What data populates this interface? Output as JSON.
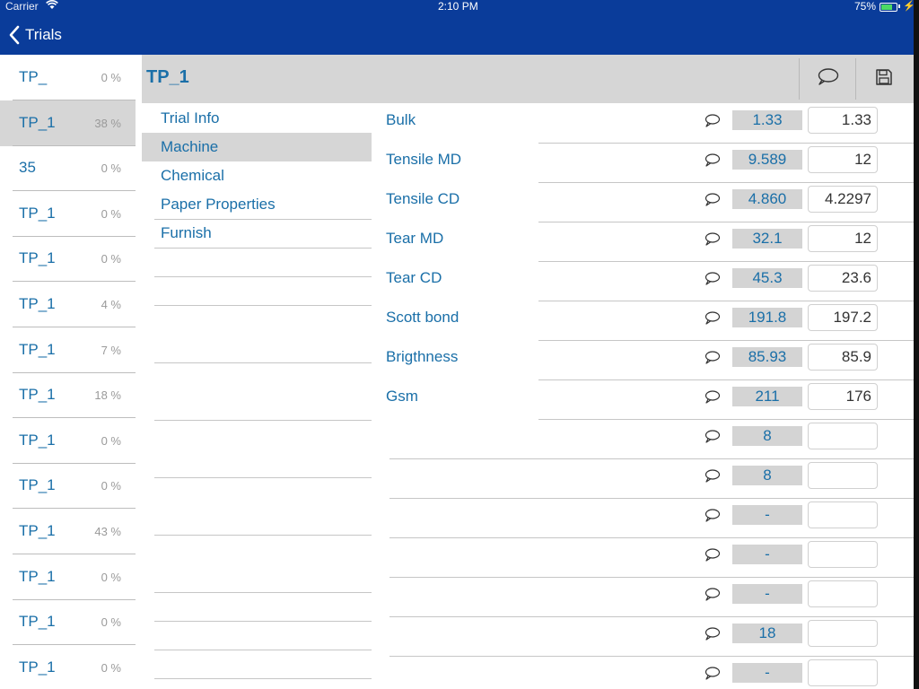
{
  "status_bar": {
    "carrier": "Carrier",
    "time": "2:10 PM",
    "battery": "75%"
  },
  "nav": {
    "back_label": "Trials"
  },
  "trials": [
    {
      "name": "TP_",
      "pct": "0 %"
    },
    {
      "name": "TP_1",
      "pct": "38 %",
      "selected": true
    },
    {
      "name": "35",
      "pct": "0 %"
    },
    {
      "name": "TP_1",
      "pct": "0 %"
    },
    {
      "name": "TP_1",
      "pct": "0 %"
    },
    {
      "name": "TP_1",
      "pct": "4 %"
    },
    {
      "name": "TP_1",
      "pct": "7 %"
    },
    {
      "name": "TP_1",
      "pct": "18 %"
    },
    {
      "name": "TP_1",
      "pct": "0 %"
    },
    {
      "name": "TP_1",
      "pct": "0 %"
    },
    {
      "name": "TP_1",
      "pct": "43 %"
    },
    {
      "name": "TP_1",
      "pct": "0 %"
    },
    {
      "name": "TP_1",
      "pct": "0 %"
    },
    {
      "name": "TP_1",
      "pct": "0 %"
    }
  ],
  "header": {
    "title": "TP_1"
  },
  "sections": [
    {
      "label": "Trial Info"
    },
    {
      "label": "Machine",
      "selected": true
    },
    {
      "label": "Chemical"
    },
    {
      "label": "Paper Properties"
    },
    {
      "label": "Furnish"
    }
  ],
  "params": [
    {
      "label": "Bulk",
      "target": "1.33",
      "actual": "1.33"
    },
    {
      "label": "Tensile MD",
      "target": "9.589",
      "actual": "12"
    },
    {
      "label": "Tensile CD",
      "target": "4.860",
      "actual": "4.2297"
    },
    {
      "label": "Tear MD",
      "target": "32.1",
      "actual": "12"
    },
    {
      "label": "Tear CD",
      "target": "45.3",
      "actual": "23.6"
    },
    {
      "label": "Scott bond",
      "target": "191.8",
      "actual": "197.2"
    },
    {
      "label": "Brigthness",
      "target": "85.93",
      "actual": "85.9"
    },
    {
      "label": "Gsm",
      "target": "211",
      "actual": "176"
    },
    {
      "label": "",
      "target": "8",
      "actual": ""
    },
    {
      "label": "",
      "target": "8",
      "actual": ""
    },
    {
      "label": "",
      "target": "-",
      "actual": ""
    },
    {
      "label": "",
      "target": "-",
      "actual": ""
    },
    {
      "label": "",
      "target": "-",
      "actual": ""
    },
    {
      "label": "",
      "target": "18",
      "actual": ""
    },
    {
      "label": "",
      "target": "-",
      "actual": ""
    }
  ],
  "colors": {
    "nav_bar": "#0a3c9a",
    "accent_text": "#1a6fa8",
    "selected_bg": "#d6d6d6"
  }
}
